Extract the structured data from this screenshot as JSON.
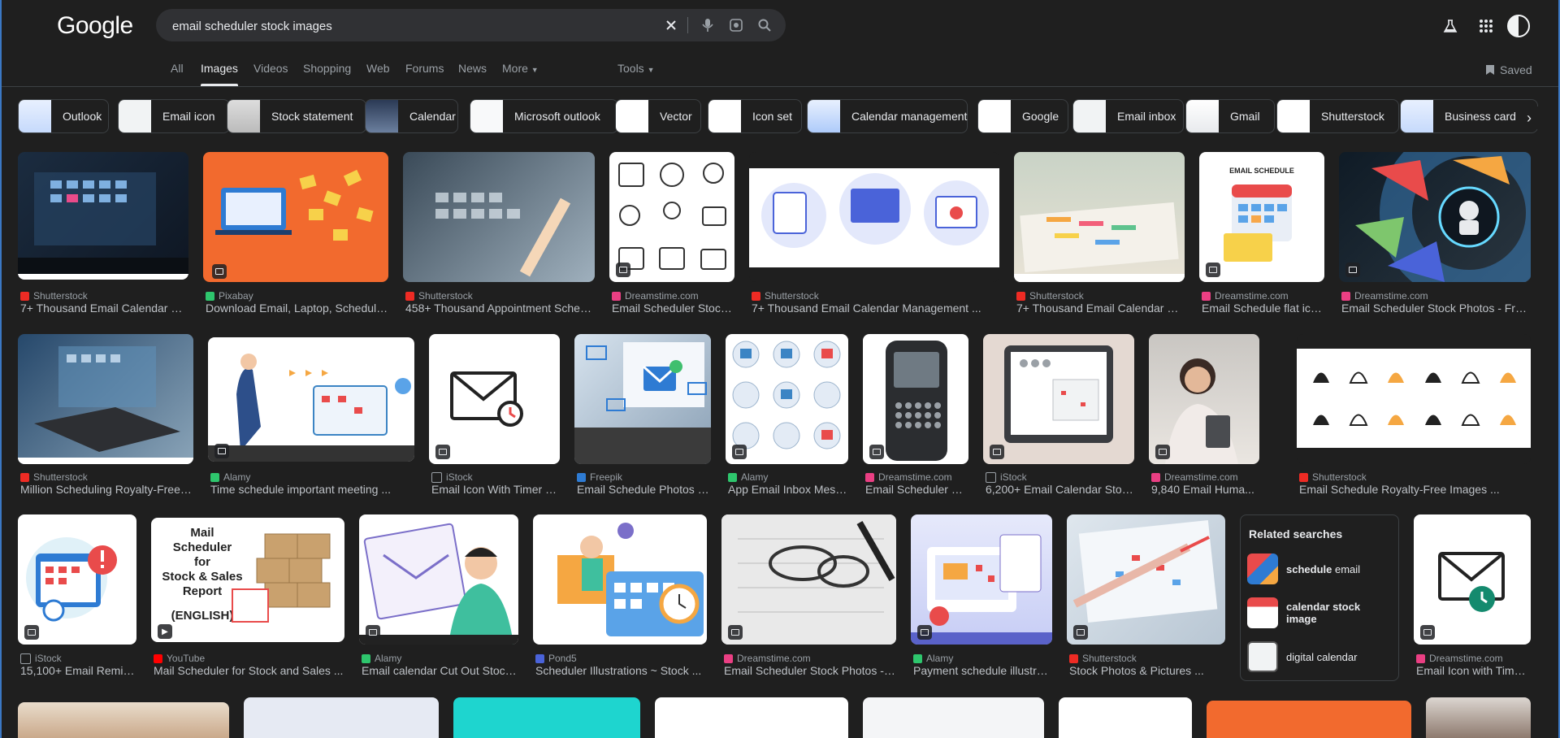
{
  "header": {
    "logo": "Google",
    "search_value": "email scheduler stock images"
  },
  "tabs": [
    "All",
    "Images",
    "Videos",
    "Shopping",
    "Web",
    "Forums",
    "News",
    "More",
    "Tools"
  ],
  "saved_label": "Saved",
  "chips": [
    "Outlook",
    "Email icon",
    "Stock statement",
    "Calendar",
    "Microsoft outlook",
    "Vector",
    "Icon set",
    "Calendar management",
    "Google",
    "Email inbox",
    "Gmail",
    "Shutterstock",
    "Business card"
  ],
  "results": [
    {
      "source": "Shutterstock",
      "title": "7+ Thousand Email Calendar Ma..."
    },
    {
      "source": "Pixabay",
      "title": "Download Email, Laptop, Schedule ..."
    },
    {
      "source": "Shutterstock",
      "title": "458+ Thousand Appointment Schedu..."
    },
    {
      "source": "Dreamstime.com",
      "title": "Email Scheduler Stock ..."
    },
    {
      "source": "Shutterstock",
      "title": "7+ Thousand Email Calendar Management ..."
    },
    {
      "source": "Shutterstock",
      "title": "7+ Thousand Email Calendar Ma..."
    },
    {
      "source": "Dreamstime.com",
      "title": "Email Schedule flat ico..."
    },
    {
      "source": "Dreamstime.com",
      "title": "Email Scheduler Stock Photos - Free ..."
    },
    {
      "source": "Shutterstock",
      "title": "Million Scheduling Royalty-Free I..."
    },
    {
      "source": "Alamy",
      "title": "Time schedule important meeting ..."
    },
    {
      "source": "iStock",
      "title": "Email Icon With Timer O..."
    },
    {
      "source": "Freepik",
      "title": "Email Schedule Photos - ..."
    },
    {
      "source": "Alamy",
      "title": "App Email Inbox Mess..."
    },
    {
      "source": "Dreamstime.com",
      "title": "Email Scheduler St..."
    },
    {
      "source": "iStock",
      "title": "6,200+ Email Calendar Stock Phot..."
    },
    {
      "source": "Dreamstime.com",
      "title": "9,840 Email Huma..."
    },
    {
      "source": "Shutterstock",
      "title": "Email Schedule Royalty-Free Images ..."
    },
    {
      "source": "iStock",
      "title": "15,100+ Email Remin..."
    },
    {
      "source": "YouTube",
      "title": "Mail Scheduler for Stock and Sales ..."
    },
    {
      "source": "Alamy",
      "title": "Email calendar Cut Out Stock ..."
    },
    {
      "source": "Pond5",
      "title": "Scheduler Illustrations ~ Stock ..."
    },
    {
      "source": "Dreamstime.com",
      "title": "Email Scheduler Stock Photos - F..."
    },
    {
      "source": "Alamy",
      "title": "Payment schedule illustrat..."
    },
    {
      "source": "Shutterstock",
      "title": "Stock Photos & Pictures ..."
    },
    {
      "source": "Dreamstime.com",
      "title": "Email Icon with Timer..."
    }
  ],
  "image_text": {
    "email_schedule": "EMAIL SCHEDULE",
    "youtube_lines": [
      "Mail",
      "Scheduler",
      "for",
      "Stock & Sales",
      "Report",
      "(ENGLISH)"
    ]
  },
  "related": {
    "heading": "Related searches",
    "items": [
      {
        "bold": "schedule",
        "rest": " email"
      },
      {
        "bold": "calendar stock image",
        "rest": ""
      },
      {
        "bold": "",
        "rest": "digital calendar"
      }
    ]
  },
  "colors": {
    "background": "#1f1f1f",
    "text": "#e8eaed",
    "muted": "#9aa0a6"
  }
}
